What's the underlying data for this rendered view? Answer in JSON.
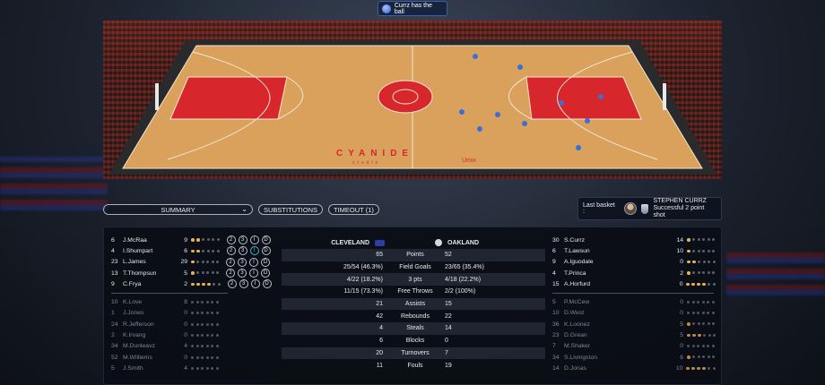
{
  "possession": {
    "text": "Currz has the ball"
  },
  "court": {
    "floor_text": "CYANIDE",
    "floor_subtext": "studio",
    "sponsor": "Umix"
  },
  "controls": {
    "view_select": "SUMMARY",
    "substitutions": "SUBSTITUTIONS",
    "timeout": "TIMEOUT (1)"
  },
  "last_basket": {
    "label": "Last basket :",
    "player": "STEPHEN CURRZ",
    "event": "Successful 2 point shot"
  },
  "home": {
    "name": "CLEVELAND",
    "starters": [
      {
        "num": "6",
        "name": "J.McRaa",
        "pts": "9",
        "rating": 2,
        "badges": [
          "2",
          "3",
          "I",
          "D"
        ],
        "highlight": -1
      },
      {
        "num": "4",
        "name": "I.Shumpart",
        "pts": "6",
        "rating": 2,
        "badges": [
          "2",
          "3",
          "I",
          "D"
        ],
        "highlight": 2
      },
      {
        "num": "23",
        "name": "L.James",
        "pts": "29",
        "rating": 1,
        "badges": [
          "2",
          "3",
          "I",
          "D"
        ],
        "highlight": -1
      },
      {
        "num": "13",
        "name": "T.Thompsun",
        "pts": "5",
        "rating": 1,
        "badges": [
          "2",
          "3",
          "I",
          "D"
        ],
        "highlight": -1
      },
      {
        "num": "9",
        "name": "C.Frya",
        "pts": "2",
        "rating": 4,
        "badges": [
          "2",
          "3",
          "I",
          "D"
        ],
        "highlight": -1
      }
    ],
    "bench": [
      {
        "num": "10",
        "name": "K.Love",
        "pts": "8",
        "rating": 0
      },
      {
        "num": "1",
        "name": "J.Jones",
        "pts": "0",
        "rating": 0
      },
      {
        "num": "24",
        "name": "R.Jefferson",
        "pts": "0",
        "rating": 0
      },
      {
        "num": "2",
        "name": "K.Irvang",
        "pts": "0",
        "rating": 0
      },
      {
        "num": "34",
        "name": "M.Dunleavz",
        "pts": "4",
        "rating": 0
      },
      {
        "num": "52",
        "name": "M.Williems",
        "pts": "0",
        "rating": 0
      },
      {
        "num": "5",
        "name": "J.Smith",
        "pts": "4",
        "rating": 0
      }
    ]
  },
  "away": {
    "name": "OAKLAND",
    "starters": [
      {
        "num": "30",
        "name": "S.Currz",
        "pts": "14",
        "rating": 1
      },
      {
        "num": "6",
        "name": "T.Lawsun",
        "pts": "10",
        "rating": 1
      },
      {
        "num": "9",
        "name": "A.Iguodale",
        "pts": "0",
        "rating": 2
      },
      {
        "num": "4",
        "name": "T.Princa",
        "pts": "2",
        "rating": 1
      },
      {
        "num": "15",
        "name": "A.Horfurd",
        "pts": "0",
        "rating": 4
      }
    ],
    "bench": [
      {
        "num": "5",
        "name": "P.McCew",
        "pts": "0",
        "rating": 0
      },
      {
        "num": "10",
        "name": "D.West",
        "pts": "0",
        "rating": 0
      },
      {
        "num": "36",
        "name": "K.Loonez",
        "pts": "5",
        "rating": 1
      },
      {
        "num": "23",
        "name": "D.Grean",
        "pts": "5",
        "rating": 3
      },
      {
        "num": "7",
        "name": "M.Shaker",
        "pts": "0",
        "rating": 0
      },
      {
        "num": "34",
        "name": "S.Livingston",
        "pts": "6",
        "rating": 1
      },
      {
        "num": "14",
        "name": "D.Jonas",
        "pts": "10",
        "rating": 4
      }
    ]
  },
  "stats": [
    {
      "home": "65",
      "label": "Points",
      "away": "52"
    },
    {
      "home": "25/54 (46.3%)",
      "label": "Field Goals",
      "away": "23/65 (35.4%)"
    },
    {
      "home": "4/22 (18.2%)",
      "label": "3 pts",
      "away": "4/18 (22.2%)"
    },
    {
      "home": "11/15 (73.3%)",
      "label": "Free Throws",
      "away": "2/2 (100%)"
    },
    {
      "home": "21",
      "label": "Assists",
      "away": "15"
    },
    {
      "home": "42",
      "label": "Rebounds",
      "away": "22"
    },
    {
      "home": "4",
      "label": "Steals",
      "away": "14"
    },
    {
      "home": "6",
      "label": "Blocks",
      "away": "0"
    },
    {
      "home": "20",
      "label": "Turnovers",
      "away": "7"
    },
    {
      "home": "11",
      "label": "Fouls",
      "away": "19"
    }
  ],
  "colors": {
    "accent": "#3d5ea8",
    "rating_on": "#e7b44b",
    "court_red": "#d8262d",
    "floor": "#d9a15c"
  }
}
